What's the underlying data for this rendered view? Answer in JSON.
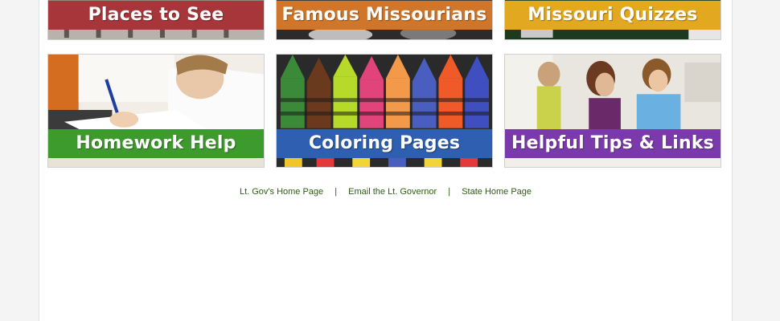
{
  "tiles": [
    {
      "label": "Places to See",
      "color": "#a6363a",
      "icon": "old-building-photo"
    },
    {
      "label": "Famous Missourians",
      "color": "#d0762a",
      "icon": "portrait-photo"
    },
    {
      "label": "Missouri Quizzes",
      "color": "#e2a81f",
      "icon": "quiz-photo"
    },
    {
      "label": "Homework Help",
      "color": "#3d9a2c",
      "icon": "student-writing-photo"
    },
    {
      "label": "Coloring Pages",
      "color": "#2e5fb0",
      "icon": "crayons-photo"
    },
    {
      "label": "Helpful Tips & Links",
      "color": "#7b3aac",
      "icon": "classroom-computers-photo"
    }
  ],
  "footer": {
    "links": [
      "Lt. Gov's Home Page",
      "Email the Lt. Governor",
      "State Home Page"
    ],
    "separator": "|"
  }
}
